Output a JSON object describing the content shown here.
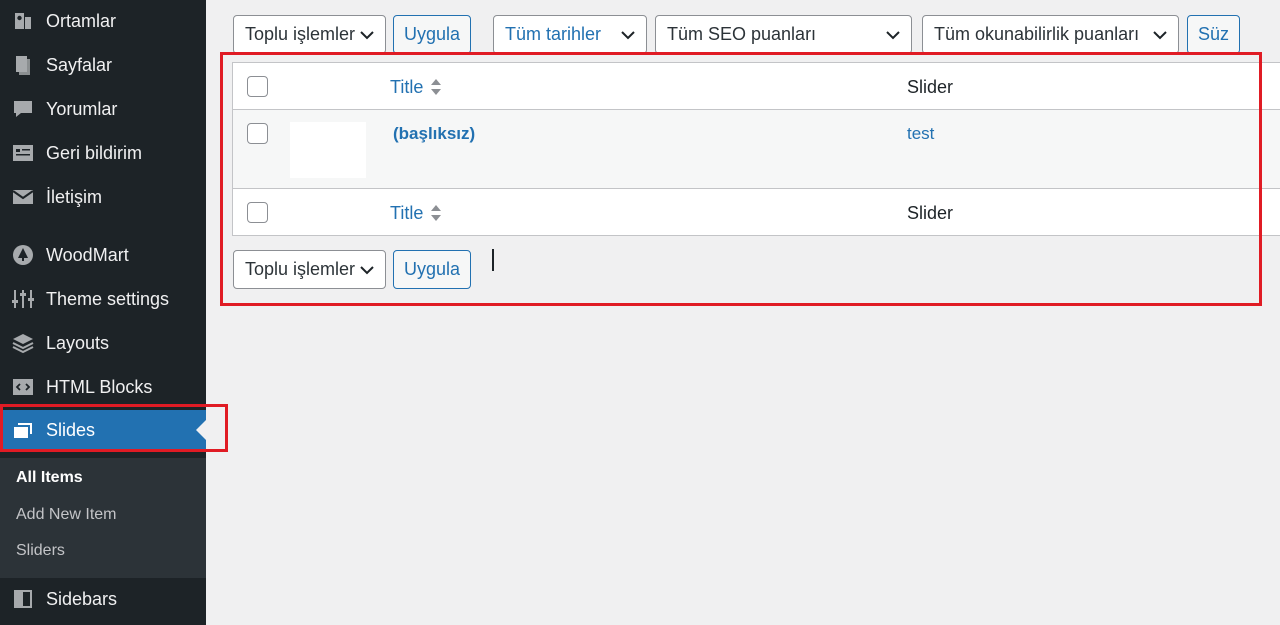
{
  "sidebar": {
    "items": [
      {
        "label": "Ortamlar",
        "icon": "media-icon"
      },
      {
        "label": "Sayfalar",
        "icon": "pages-icon"
      },
      {
        "label": "Yorumlar",
        "icon": "comments-icon"
      },
      {
        "label": "Geri bildirim",
        "icon": "feedback-icon"
      },
      {
        "label": "İletişim",
        "icon": "mail-icon"
      },
      {
        "label": "WoodMart",
        "icon": "woodmart-icon"
      },
      {
        "label": "Theme settings",
        "icon": "sliders-icon"
      },
      {
        "label": "Layouts",
        "icon": "layers-icon"
      },
      {
        "label": "HTML Blocks",
        "icon": "code-block-icon"
      },
      {
        "label": "Slides",
        "icon": "slides-icon"
      },
      {
        "label": "Sidebars",
        "icon": "sidebar-icon"
      }
    ],
    "submenu": [
      {
        "label": "All Items"
      },
      {
        "label": "Add New Item"
      },
      {
        "label": "Sliders"
      }
    ]
  },
  "filters": {
    "bulk_actions": "Toplu işlemler",
    "apply": "Uygula",
    "dates": "Tüm tarihler",
    "seo": "Tüm SEO puanları",
    "readability": "Tüm okunabilirlik puanları",
    "filter": "Süz"
  },
  "table": {
    "col_title": "Title",
    "col_slider": "Slider",
    "rows": [
      {
        "title": "(başlıksız)",
        "slider": "test"
      }
    ]
  },
  "bottom": {
    "bulk_actions": "Toplu işlemler",
    "apply": "Uygula"
  },
  "colors": {
    "sidebar_bg": "#1d2327",
    "accent": "#2271b1",
    "highlight": "#e01b24"
  }
}
